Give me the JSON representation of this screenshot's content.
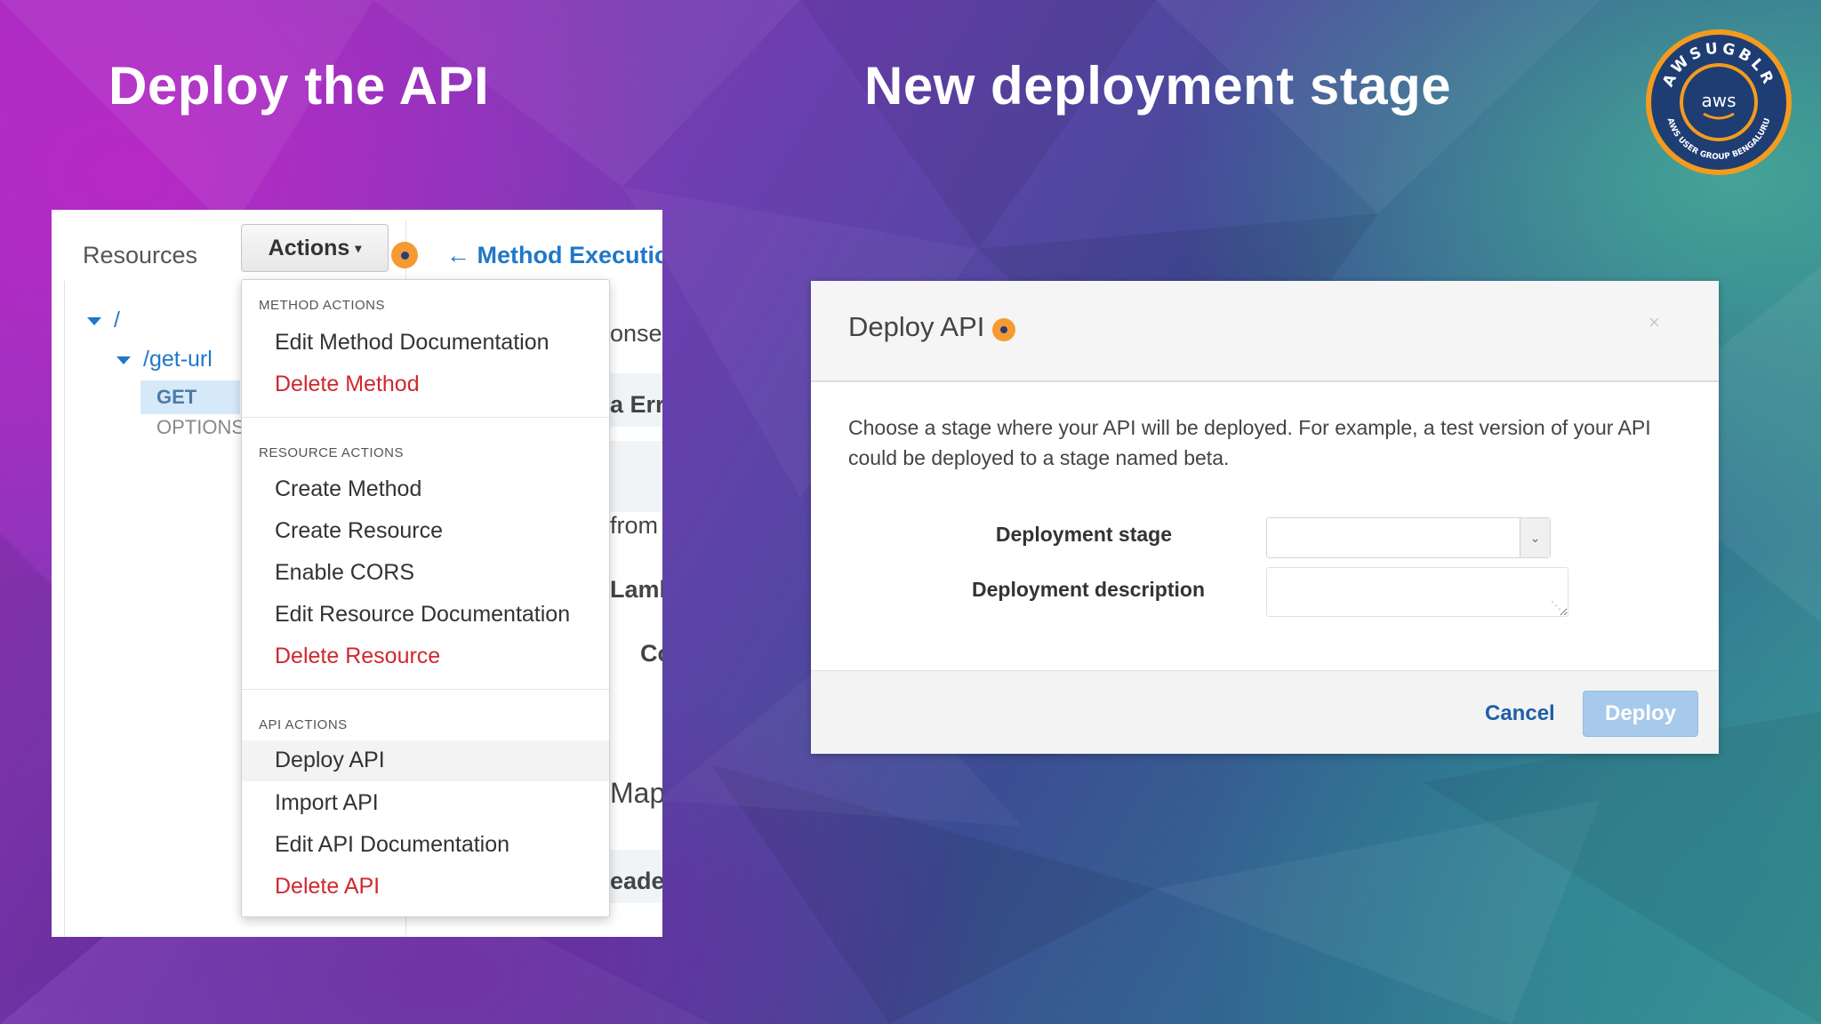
{
  "slide": {
    "title_left": "Deploy the API",
    "title_right": "New deployment stage"
  },
  "logo": {
    "ring_text": "AWSUGBLR",
    "center_text": "aws",
    "bottom_text": "AWS USER GROUP BENGALURU",
    "colors": {
      "ring": "#f49b1d",
      "inner": "#1e3d73"
    }
  },
  "console": {
    "resources_label": "Resources",
    "actions_button": "Actions",
    "method_execution": "Method Execution",
    "tree": {
      "root": "/",
      "resource": "/get-url",
      "method_get": "GET",
      "method_options": "OPTIONS"
    },
    "background_fragments": [
      "onse",
      "a Erro",
      "from y",
      "Lamb",
      "Co",
      "Mapp",
      "eader"
    ],
    "menu": {
      "sections": [
        {
          "header": "METHOD ACTIONS",
          "items": [
            {
              "label": "Edit Method Documentation",
              "danger": false
            },
            {
              "label": "Delete Method",
              "danger": true
            }
          ]
        },
        {
          "header": "RESOURCE ACTIONS",
          "items": [
            {
              "label": "Create Method",
              "danger": false
            },
            {
              "label": "Create Resource",
              "danger": false
            },
            {
              "label": "Enable CORS",
              "danger": false
            },
            {
              "label": "Edit Resource Documentation",
              "danger": false
            },
            {
              "label": "Delete Resource",
              "danger": true
            }
          ]
        },
        {
          "header": "API ACTIONS",
          "items": [
            {
              "label": "Deploy API",
              "danger": false,
              "highlighted": true
            },
            {
              "label": "Import API",
              "danger": false
            },
            {
              "label": "Edit API Documentation",
              "danger": false
            },
            {
              "label": "Delete API",
              "danger": true
            }
          ]
        }
      ]
    },
    "colors": {
      "link": "#1f78c8",
      "danger": "#d0282e",
      "info_dot": "#f59a32"
    }
  },
  "modal": {
    "title": "Deploy API",
    "close": "×",
    "description": "Choose a stage where your API will be deployed. For example, a test version of your API could be deployed to a stage named beta.",
    "fields": {
      "stage_label": "Deployment stage",
      "stage_value": "",
      "description_label": "Deployment description",
      "description_value": ""
    },
    "buttons": {
      "cancel": "Cancel",
      "deploy": "Deploy"
    }
  }
}
